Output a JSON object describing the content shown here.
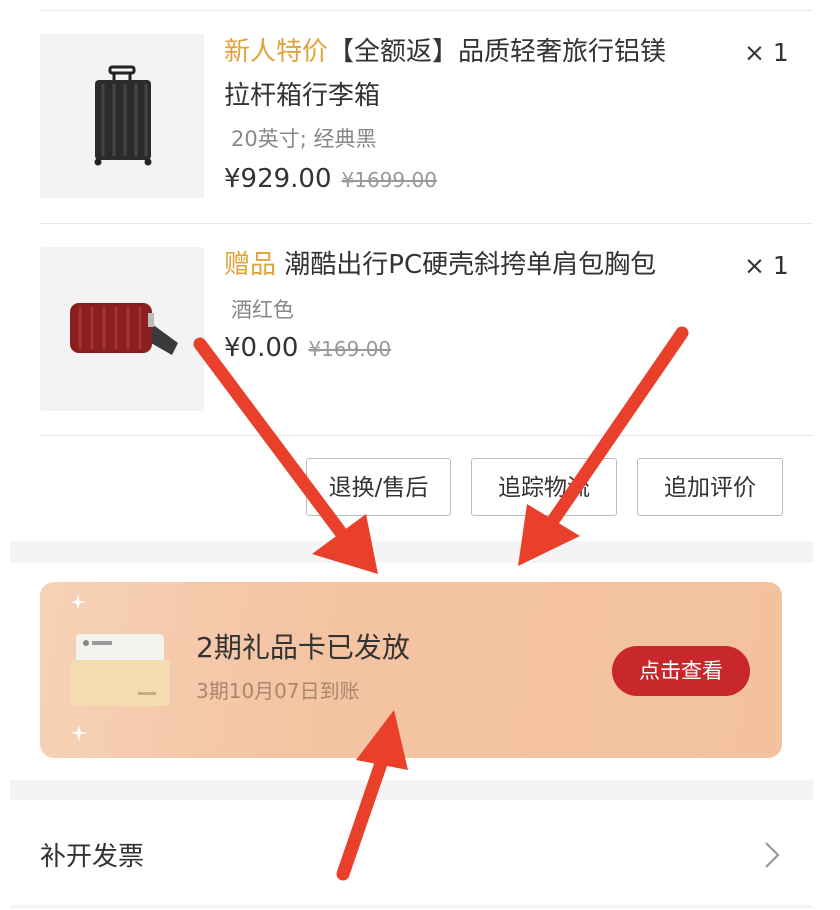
{
  "items": [
    {
      "tag": "新人特价",
      "title": "【全额返】品质轻奢旅行铝镁",
      "title_line2": "拉杆箱行李箱",
      "spec": "20英寸; 经典黑",
      "price": "¥929.00",
      "original_price": "¥1699.00",
      "qty": "× 1",
      "image_icon": "luggage-icon"
    },
    {
      "tag": "赠品",
      "title": "潮酷出行PC硬壳斜挎单肩包胸包",
      "spec": "酒红色",
      "price": "¥0.00",
      "original_price": "¥169.00",
      "qty": "× 1",
      "image_icon": "bag-icon"
    }
  ],
  "actions": {
    "return_label": "退换/售后",
    "track_label": "追踪物流",
    "review_label": "追加评价"
  },
  "gift_card": {
    "title": "2期礼品卡已发放",
    "subtitle": "3期10月07日到账",
    "button_label": "点击查看",
    "colors": {
      "button": "#c8272c",
      "background": "#f4c4a3"
    }
  },
  "invoice": {
    "label": "补开发票"
  },
  "colors": {
    "tag": "#e1a339",
    "annotation_arrow": "#e8402a"
  }
}
